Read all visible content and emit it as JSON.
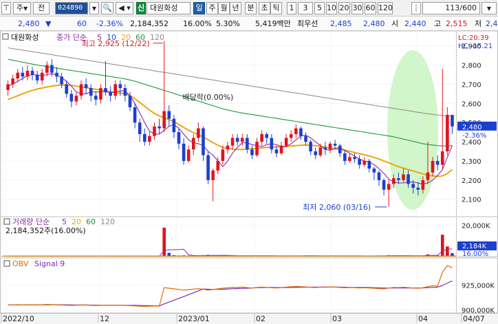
{
  "toolbar": {
    "type_label": "주",
    "prev_label": "전",
    "code": "024890",
    "info_label": "신",
    "stock_name": "대원화성",
    "periods": [
      "일",
      "주",
      "월",
      "년",
      "분",
      "초",
      "틱"
    ],
    "active_period": "일",
    "intervals": [
      "1",
      "3",
      "5",
      "10",
      "20",
      "30",
      "60",
      "120"
    ],
    "count_display": "113/600"
  },
  "quote": {
    "price": "2,480",
    "direction": "▼",
    "change": "60",
    "change_pct": "-2.36%",
    "volume": "2,184,352",
    "volume_ratio": "16.00%",
    "turnover": "5.30%",
    "amount": "5,419백만",
    "priority_label": "최우선",
    "ask": "2,485",
    "bid": "2,480",
    "open_label": "시",
    "open": "2,440",
    "high_label": "고",
    "high": "2,515",
    "low_label": "저",
    "low": "2,4"
  },
  "colors": {
    "up": "#e0141e",
    "down": "#1b3fd1",
    "ma5": "#8e27a8",
    "ma10": "#1f3fd6",
    "ma20": "#f0a30a",
    "ma60": "#1a9a3a",
    "ma120": "#8a8a8a",
    "highlight": "#c9f5c0",
    "obv": "#e06a00",
    "signal": "#7a2bb8"
  },
  "price_panel": {
    "legend_name": "대원화성",
    "legend_ma_label": "종가 단순",
    "legend_ma_periods": [
      "5",
      "10",
      "20",
      "60",
      "120"
    ],
    "lc_label": "LC:20.39",
    "hc_label": "HC:-15.21",
    "high_annotation": "최고 2,925 (12/22)",
    "low_annotation": "최저 2,060 (03/16)",
    "dividend_annotation": "배당락(0.00%)",
    "price_tag": "2,480",
    "price_tag_pct": "-2.36%",
    "y_ticks": [
      "2,900",
      "2,800",
      "2,700",
      "2,600",
      "2,500",
      "2,400",
      "2,300",
      "2,200",
      "2,100"
    ]
  },
  "volume_panel": {
    "legend": "거래량 단순",
    "legend_ma_periods": [
      "5",
      "20",
      "60",
      "120"
    ],
    "summary": "2,184,352주(16.00%)",
    "y_ticks": [
      "20,000K",
      "10,000K"
    ],
    "current_tag": "2,184K",
    "current_pct": "16.00%"
  },
  "obv_panel": {
    "legend_obv": "OBV",
    "legend_signal": "Signal 9",
    "y_ticks": [
      "925,000K",
      "900,000K"
    ]
  },
  "x_axis": [
    "2022/10",
    "12",
    "2023/01",
    "02",
    "03",
    "04",
    "04/07"
  ],
  "chart_data": {
    "type": "candlestick",
    "ylim": [
      2020,
      2960
    ],
    "dates": [
      "2022/10",
      "12",
      "2023/01",
      "02",
      "03",
      "04"
    ],
    "candles": [
      [
        2670,
        2700,
        2640,
        2720
      ],
      [
        2700,
        2730,
        2680,
        2750
      ],
      [
        2730,
        2760,
        2710,
        2780
      ],
      [
        2760,
        2740,
        2720,
        2790
      ],
      [
        2740,
        2770,
        2720,
        2800
      ],
      [
        2770,
        2750,
        2720,
        2790
      ],
      [
        2750,
        2720,
        2700,
        2770
      ],
      [
        2720,
        2760,
        2700,
        2780
      ],
      [
        2760,
        2800,
        2740,
        2820
      ],
      [
        2800,
        2760,
        2740,
        2830
      ],
      [
        2760,
        2740,
        2710,
        2790
      ],
      [
        2740,
        2700,
        2680,
        2760
      ],
      [
        2700,
        2650,
        2630,
        2720
      ],
      [
        2650,
        2610,
        2580,
        2670
      ],
      [
        2610,
        2640,
        2590,
        2660
      ],
      [
        2640,
        2700,
        2620,
        2720
      ],
      [
        2700,
        2680,
        2650,
        2730
      ],
      [
        2680,
        2640,
        2610,
        2700
      ],
      [
        2640,
        2620,
        2590,
        2660
      ],
      [
        2620,
        2680,
        2600,
        2700
      ],
      [
        2680,
        2660,
        2640,
        2820
      ],
      [
        2660,
        2640,
        2610,
        2690
      ],
      [
        2640,
        2700,
        2620,
        2720
      ],
      [
        2700,
        2680,
        2640,
        2720
      ],
      [
        2680,
        2640,
        2610,
        2700
      ],
      [
        2640,
        2580,
        2560,
        2660
      ],
      [
        2580,
        2500,
        2470,
        2600
      ],
      [
        2500,
        2440,
        2400,
        2520
      ],
      [
        2440,
        2400,
        2380,
        2470
      ],
      [
        2400,
        2430,
        2380,
        2450
      ],
      [
        2430,
        2480,
        2410,
        2500
      ],
      [
        2480,
        2470,
        2440,
        2520
      ],
      [
        2470,
        2560,
        2450,
        2925
      ],
      [
        2560,
        2520,
        2480,
        2590
      ],
      [
        2520,
        2450,
        2420,
        2540
      ],
      [
        2450,
        2390,
        2360,
        2470
      ],
      [
        2390,
        2300,
        2280,
        2420
      ],
      [
        2300,
        2360,
        2290,
        2380
      ],
      [
        2360,
        2420,
        2330,
        2440
      ],
      [
        2420,
        2470,
        2400,
        2500
      ],
      [
        2470,
        2330,
        2300,
        2480
      ],
      [
        2330,
        2200,
        2180,
        2350
      ],
      [
        2200,
        2250,
        2090,
        2260
      ],
      [
        2250,
        2300,
        2230,
        2320
      ],
      [
        2300,
        2360,
        2280,
        2380
      ],
      [
        2360,
        2380,
        2340,
        2400
      ],
      [
        2380,
        2420,
        2360,
        2440
      ],
      [
        2420,
        2400,
        2380,
        2440
      ],
      [
        2400,
        2420,
        2380,
        2440
      ],
      [
        2420,
        2360,
        2340,
        2440
      ],
      [
        2360,
        2330,
        2310,
        2380
      ],
      [
        2330,
        2400,
        2320,
        2420
      ],
      [
        2400,
        2440,
        2380,
        2460
      ],
      [
        2440,
        2420,
        2390,
        2450
      ],
      [
        2420,
        2360,
        2340,
        2440
      ],
      [
        2360,
        2340,
        2320,
        2380
      ],
      [
        2340,
        2380,
        2330,
        2400
      ],
      [
        2380,
        2420,
        2370,
        2440
      ],
      [
        2420,
        2440,
        2400,
        2460
      ],
      [
        2440,
        2470,
        2420,
        2490
      ],
      [
        2470,
        2430,
        2410,
        2480
      ],
      [
        2430,
        2400,
        2380,
        2450
      ],
      [
        2400,
        2350,
        2330,
        2410
      ],
      [
        2350,
        2330,
        2310,
        2370
      ],
      [
        2330,
        2370,
        2320,
        2390
      ],
      [
        2370,
        2360,
        2330,
        2400
      ],
      [
        2360,
        2390,
        2340,
        2400
      ],
      [
        2390,
        2380,
        2360,
        2410
      ],
      [
        2380,
        2340,
        2320,
        2390
      ],
      [
        2340,
        2300,
        2280,
        2360
      ],
      [
        2300,
        2320,
        2290,
        2340
      ],
      [
        2320,
        2310,
        2290,
        2340
      ],
      [
        2310,
        2280,
        2260,
        2330
      ],
      [
        2280,
        2300,
        2270,
        2320
      ],
      [
        2300,
        2260,
        2240,
        2310
      ],
      [
        2260,
        2240,
        2200,
        2270
      ],
      [
        2240,
        2200,
        2170,
        2250
      ],
      [
        2200,
        2150,
        2120,
        2210
      ],
      [
        2150,
        2180,
        2060,
        2200
      ],
      [
        2180,
        2210,
        2160,
        2230
      ],
      [
        2210,
        2200,
        2180,
        2240
      ],
      [
        2200,
        2230,
        2190,
        2260
      ],
      [
        2230,
        2180,
        2160,
        2250
      ],
      [
        2180,
        2160,
        2130,
        2200
      ],
      [
        2160,
        2150,
        2120,
        2190
      ],
      [
        2150,
        2200,
        2130,
        2220
      ],
      [
        2200,
        2240,
        2180,
        2400
      ],
      [
        2240,
        2300,
        2220,
        2320
      ],
      [
        2300,
        2280,
        2250,
        2330
      ],
      [
        2280,
        2350,
        2260,
        2780
      ],
      [
        2350,
        2540,
        2330,
        2580
      ],
      [
        2540,
        2480,
        2440,
        2515
      ]
    ],
    "ma5": [
      2690,
      2700,
      2715,
      2730,
      2745,
      2750,
      2748,
      2745,
      2750,
      2755,
      2748,
      2735,
      2715,
      2690,
      2660,
      2650,
      2650,
      2660,
      2660,
      2660,
      2660,
      2655,
      2660,
      2665,
      2665,
      2640,
      2600,
      2550,
      2500,
      2455,
      2440,
      2440,
      2460,
      2480,
      2490,
      2470,
      2440,
      2410,
      2395,
      2390,
      2380,
      2350,
      2330,
      2300,
      2270,
      2300,
      2340,
      2370,
      2395,
      2395,
      2385,
      2380,
      2375,
      2385,
      2390,
      2385,
      2375,
      2375,
      2390,
      2410,
      2430,
      2435,
      2420,
      2400,
      2380,
      2360,
      2355,
      2365,
      2370,
      2355,
      2340,
      2325,
      2310,
      2300,
      2295,
      2280,
      2260,
      2235,
      2205,
      2190,
      2185,
      2185,
      2190,
      2190,
      2185,
      2180,
      2185,
      2200,
      2225,
      2255,
      2320,
      2380
    ],
    "ma20": [
      2620,
      2630,
      2640,
      2650,
      2660,
      2668,
      2675,
      2680,
      2686,
      2690,
      2694,
      2696,
      2696,
      2694,
      2690,
      2686,
      2682,
      2678,
      2674,
      2670,
      2666,
      2662,
      2658,
      2654,
      2650,
      2640,
      2625,
      2605,
      2585,
      2565,
      2548,
      2535,
      2525,
      2515,
      2505,
      2490,
      2475,
      2460,
      2448,
      2437,
      2425,
      2410,
      2395,
      2382,
      2370,
      2365,
      2362,
      2360,
      2360,
      2362,
      2364,
      2366,
      2368,
      2370,
      2372,
      2373,
      2374,
      2376,
      2378,
      2380,
      2382,
      2383,
      2382,
      2380,
      2376,
      2372,
      2368,
      2364,
      2360,
      2355,
      2350,
      2344,
      2338,
      2332,
      2326,
      2318,
      2310,
      2300,
      2290,
      2280,
      2270,
      2262,
      2255,
      2248,
      2240,
      2232,
      2226,
      2222,
      2220,
      2222,
      2235,
      2255
    ],
    "ma60": [
      2830,
      2825,
      2820,
      2815,
      2810,
      2805,
      2800,
      2796,
      2792,
      2788,
      2784,
      2780,
      2776,
      2772,
      2768,
      2764,
      2760,
      2756,
      2752,
      2748,
      2744,
      2740,
      2736,
      2732,
      2728,
      2722,
      2716,
      2708,
      2700,
      2692,
      2684,
      2676,
      2668,
      2660,
      2652,
      2644,
      2636,
      2628,
      2620,
      2612,
      2604,
      2596,
      2588,
      2580,
      2572,
      2566,
      2560,
      2555,
      2550,
      2546,
      2542,
      2538,
      2534,
      2530,
      2526,
      2522,
      2518,
      2514,
      2510,
      2506,
      2502,
      2498,
      2494,
      2490,
      2486,
      2482,
      2478,
      2474,
      2470,
      2466,
      2462,
      2458,
      2454,
      2450,
      2446,
      2442,
      2438,
      2434,
      2430,
      2426,
      2420,
      2414,
      2408,
      2402,
      2396,
      2390,
      2386,
      2383,
      2380,
      2378,
      2378,
      2380
    ],
    "ma120": [
      2890,
      2886,
      2882,
      2878,
      2874,
      2870,
      2866,
      2862,
      2858,
      2854,
      2850,
      2846,
      2842,
      2838,
      2834,
      2830,
      2826,
      2822,
      2818,
      2814,
      2810,
      2806,
      2802,
      2798,
      2794,
      2790,
      2786,
      2782,
      2778,
      2774,
      2770,
      2766,
      2762,
      2758,
      2754,
      2750,
      2746,
      2742,
      2738,
      2734,
      2730,
      2726,
      2722,
      2718,
      2714,
      2710,
      2706,
      2702,
      2698,
      2694,
      2690,
      2686,
      2682,
      2678,
      2674,
      2670,
      2666,
      2662,
      2658,
      2654,
      2650,
      2646,
      2642,
      2638,
      2634,
      2630,
      2626,
      2622,
      2618,
      2614,
      2610,
      2606,
      2602,
      2598,
      2594,
      2590,
      2586,
      2582,
      2578,
      2574,
      2570,
      2566,
      2562,
      2558,
      2554,
      2550,
      2546,
      2543,
      2540,
      2537,
      2535,
      2534
    ],
    "volume": [
      300,
      260,
      280,
      310,
      250,
      240,
      220,
      260,
      280,
      240,
      230,
      250,
      260,
      240,
      220,
      230,
      240,
      220,
      210,
      230,
      400,
      220,
      230,
      210,
      200,
      250,
      280,
      300,
      260,
      240,
      250,
      260,
      18500,
      2400,
      900,
      700,
      800,
      600,
      500,
      520,
      800,
      1100,
      900,
      700,
      600,
      550,
      520,
      500,
      480,
      520,
      560,
      540,
      520,
      500,
      480,
      460,
      470,
      490,
      510,
      530,
      520,
      500,
      520,
      480,
      460,
      450,
      470,
      480,
      460,
      470,
      480,
      460,
      450,
      440,
      460,
      480,
      500,
      520,
      900,
      600,
      550,
      520,
      600,
      560,
      540,
      620,
      1400,
      900,
      800,
      14000,
      6500,
      2184
    ],
    "obv": [
      905,
      905.2,
      905.4,
      905.1,
      905.3,
      905.2,
      905.0,
      905.3,
      905.6,
      905.4,
      905.2,
      905.0,
      904.8,
      904.6,
      904.8,
      905.0,
      904.9,
      904.7,
      904.5,
      904.7,
      904.9,
      904.7,
      904.9,
      904.8,
      904.6,
      904.4,
      904.1,
      903.8,
      903.6,
      903.8,
      904.0,
      903.9,
      922.4,
      921.8,
      921.2,
      920.6,
      919.9,
      920.4,
      920.9,
      921.4,
      920.8,
      919.9,
      920.6,
      921.2,
      921.8,
      922.3,
      922.8,
      922.6,
      922.9,
      922.4,
      922.0,
      922.5,
      923.0,
      922.7,
      922.3,
      922.0,
      922.4,
      922.9,
      923.3,
      923.7,
      923.4,
      923.1,
      922.8,
      922.5,
      922.9,
      922.7,
      923.1,
      922.9,
      922.6,
      922.3,
      922.6,
      922.4,
      922.1,
      922.3,
      922.0,
      921.8,
      921.5,
      921.2,
      922.0,
      922.6,
      922.4,
      922.8,
      922.4,
      922.0,
      921.8,
      922.3,
      923.4,
      924.2,
      924.0,
      938.0,
      944.5,
      942.3
    ]
  }
}
